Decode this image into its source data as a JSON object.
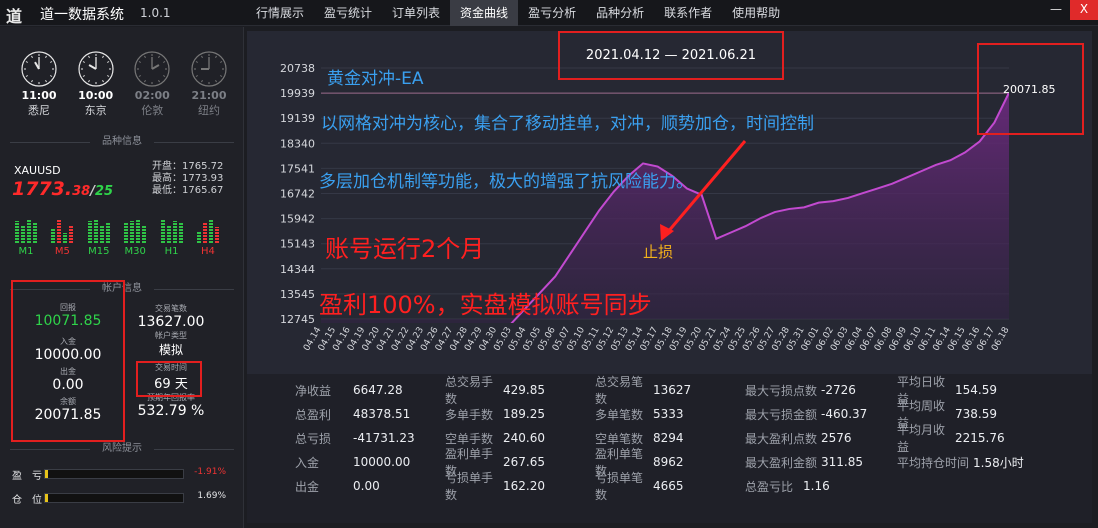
{
  "app": {
    "logo": "道",
    "title": "道一数据系统",
    "version": "1.0.1"
  },
  "nav": [
    "行情展示",
    "盈亏统计",
    "订单列表",
    "资金曲线",
    "盈亏分析",
    "品种分析",
    "联系作者",
    "使用帮助"
  ],
  "nav_active": 3,
  "window": {
    "minimize": "—",
    "close": "X"
  },
  "clocks": [
    {
      "time": "11:00",
      "city": "悉尼",
      "active": true
    },
    {
      "time": "10:00",
      "city": "东京",
      "active": true
    },
    {
      "time": "02:00",
      "city": "伦敦",
      "active": false
    },
    {
      "time": "21:00",
      "city": "纽约",
      "active": false
    }
  ],
  "sections": {
    "instrument": "品种信息",
    "account": "帐户信息",
    "risk": "风险提示"
  },
  "instrument": {
    "symbol": "XAUUSD",
    "price_main": "1773.",
    "price_frac": "38",
    "price_sep": "/",
    "spread": "25",
    "open": "开盘：1765.72",
    "high": "最高：1773.93",
    "low": "最低：1765.67",
    "timeframes": [
      {
        "label": "M1",
        "color": "green"
      },
      {
        "label": "M5",
        "color": "red"
      },
      {
        "label": "M15",
        "color": "green"
      },
      {
        "label": "M30",
        "color": "green"
      },
      {
        "label": "H1",
        "color": "green"
      },
      {
        "label": "H4",
        "color": "red"
      }
    ]
  },
  "account": {
    "net_label": "回报",
    "net_value": "10071.85",
    "deposit_label": "入金",
    "deposit_value": "10000.00",
    "withdraw_label": "出金",
    "withdraw_value": "0.00",
    "balance_label": "余额",
    "balance_value": "20071.85",
    "trades_label": "交易笔数",
    "trades_value": "13627.00",
    "type_label": "帐户类型",
    "type_value": "模拟",
    "time_label": "交易时间",
    "time_value": "69 天",
    "annual_label": "预期年回报率",
    "annual_value": "532.79 %"
  },
  "risk": {
    "pl_label": "盈　亏",
    "pl_value": "-1.91%",
    "pl_level": 0.02,
    "pos_label": "仓　位",
    "pos_value": "1.69%",
    "pos_level": 0.02
  },
  "chart_overlay": {
    "date_range": "2021.04.12 — 2021.06.21",
    "last_value": "20071.85",
    "ea_title": "黄金对冲-EA",
    "desc1": "以网格对冲为核心，集合了移动挂单，对冲，顺势加仓，时间控制",
    "desc2": "多层加仓机制等功能，极大的增强了抗风险能力。",
    "run": "账号运行2个月",
    "profit": "盈利100%，实盘模拟账号同步",
    "stop": "止损"
  },
  "chart_data": {
    "type": "area",
    "ylim": [
      12745,
      20738
    ],
    "yticks": [
      "20738",
      "19939",
      "19139",
      "18340",
      "17541",
      "16742",
      "15942",
      "15143",
      "14344",
      "13545",
      "12745"
    ],
    "x": [
      "04.14",
      "04.15",
      "04.16",
      "04.19",
      "04.20",
      "04.21",
      "04.22",
      "04.23",
      "04.26",
      "04.27",
      "04.28",
      "04.29",
      "04.30",
      "05.03",
      "05.04",
      "05.05",
      "05.06",
      "05.07",
      "05.10",
      "05.11",
      "05.12",
      "05.13",
      "05.14",
      "05.17",
      "05.18",
      "05.19",
      "05.20",
      "05.21",
      "05.24",
      "05.25",
      "05.26",
      "05.27",
      "05.28",
      "05.31",
      "06.01",
      "06.02",
      "06.03",
      "06.04",
      "06.07",
      "06.08",
      "06.09",
      "06.10",
      "06.11",
      "06.14",
      "06.15",
      "06.16",
      "06.17",
      "06.18"
    ],
    "values": [
      10000,
      10150,
      10300,
      10500,
      10650,
      10800,
      10950,
      11100,
      11300,
      11500,
      11700,
      11900,
      12200,
      12600,
      13100,
      13600,
      14100,
      14800,
      15500,
      16200,
      16800,
      17300,
      17700,
      17600,
      17300,
      16900,
      16700,
      15300,
      15500,
      15700,
      15950,
      16150,
      16250,
      16300,
      16450,
      16500,
      16600,
      16750,
      16900,
      17050,
      17250,
      17450,
      17650,
      17800,
      18050,
      18400,
      19000,
      19950
    ],
    "grid": true,
    "fill_color": "#5a2a6a",
    "line_color": "#c24ad0"
  },
  "stats": [
    [
      [
        "净收益",
        "6647.28"
      ],
      [
        "总盈利",
        "48378.51"
      ],
      [
        "总亏损",
        "-41731.23"
      ],
      [
        "入金",
        "10000.00"
      ],
      [
        "出金",
        "0.00"
      ]
    ],
    [
      [
        "总交易手数",
        "429.85"
      ],
      [
        "多单手数",
        "189.25"
      ],
      [
        "空单手数",
        "240.60"
      ],
      [
        "盈利单手数",
        "267.65"
      ],
      [
        "亏损单手数",
        "162.20"
      ]
    ],
    [
      [
        "总交易笔数",
        "13627"
      ],
      [
        "多单笔数",
        "5333"
      ],
      [
        "空单笔数",
        "8294"
      ],
      [
        "盈利单笔数",
        "8962"
      ],
      [
        "亏损单笔数",
        "4665"
      ]
    ],
    [
      [
        "最大亏损点数",
        "-2726"
      ],
      [
        "最大亏损金额",
        "-460.37"
      ],
      [
        "最大盈利点数",
        "2576"
      ],
      [
        "最大盈利金额",
        "311.85"
      ],
      [
        "总盈亏比",
        "1.16"
      ]
    ],
    [
      [
        "平均日收益",
        "154.59"
      ],
      [
        "平均周收益",
        "738.59"
      ],
      [
        "平均月收益",
        "2215.76"
      ],
      [
        "平均持仓时间",
        "1.58小时"
      ]
    ]
  ]
}
